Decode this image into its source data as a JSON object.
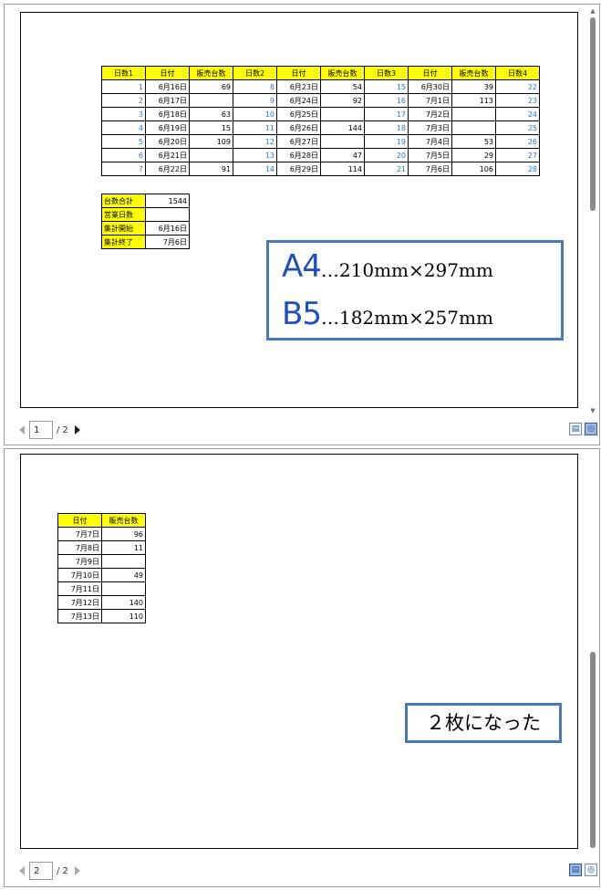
{
  "pages": [
    {
      "page_input": "1",
      "page_total": "/ 2"
    },
    {
      "page_input": "2",
      "page_total": "/ 2"
    }
  ],
  "main_table": {
    "headers": [
      "日数1",
      "日付",
      "販売台数",
      "日数2",
      "日付",
      "販売台数",
      "日数3",
      "日付",
      "販売台数",
      "日数4"
    ],
    "rows": [
      [
        "1",
        "6月16日",
        "69",
        "8",
        "6月23日",
        "54",
        "15",
        "6月30日",
        "39",
        "22"
      ],
      [
        "2",
        "6月17日",
        "",
        "9",
        "6月24日",
        "92",
        "16",
        "7月1日",
        "113",
        "23"
      ],
      [
        "3",
        "6月18日",
        "63",
        "10",
        "6月25日",
        "",
        "17",
        "7月2日",
        "",
        "24"
      ],
      [
        "4",
        "6月19日",
        "15",
        "11",
        "6月26日",
        "144",
        "18",
        "7月3日",
        "",
        "25"
      ],
      [
        "5",
        "6月20日",
        "109",
        "12",
        "6月27日",
        "",
        "19",
        "7月4日",
        "53",
        "26"
      ],
      [
        "6",
        "6月21日",
        "",
        "13",
        "6月28日",
        "47",
        "20",
        "7月5日",
        "29",
        "27"
      ],
      [
        "7",
        "6月22日",
        "91",
        "14",
        "6月29日",
        "114",
        "21",
        "7月6日",
        "106",
        "28"
      ]
    ]
  },
  "summary_table": {
    "rows": [
      [
        "台数合計",
        "1544"
      ],
      [
        "営業日数",
        ""
      ],
      [
        "集計開始",
        "6月16日"
      ],
      [
        "集計終了",
        "7月6日"
      ]
    ]
  },
  "page2_table": {
    "headers": [
      "日付",
      "販売台数"
    ],
    "rows": [
      [
        "7月7日",
        "96"
      ],
      [
        "7月8日",
        "11"
      ],
      [
        "7月9日",
        ""
      ],
      [
        "7月10日",
        "49"
      ],
      [
        "7月11日",
        ""
      ],
      [
        "7月12日",
        "140"
      ],
      [
        "7月13日",
        "110"
      ]
    ]
  },
  "callout_size": {
    "a4_label": "A4",
    "a4_dims": "…210mm×297mm",
    "b5_label": "B5",
    "b5_dims": "…182mm×257mm"
  },
  "callout_pages": {
    "text": "２枚になった"
  },
  "colors": {
    "header_fill": "#ffff00",
    "day_number_text": "#2e75d0",
    "callout_border": "#4a78b8",
    "callout_label_text": "#1f4fbf"
  },
  "icons": {
    "prev": "triangle-left-icon",
    "next": "triangle-right-icon",
    "page_view": "page-view-icon",
    "zoom": "zoom-target-icon"
  }
}
